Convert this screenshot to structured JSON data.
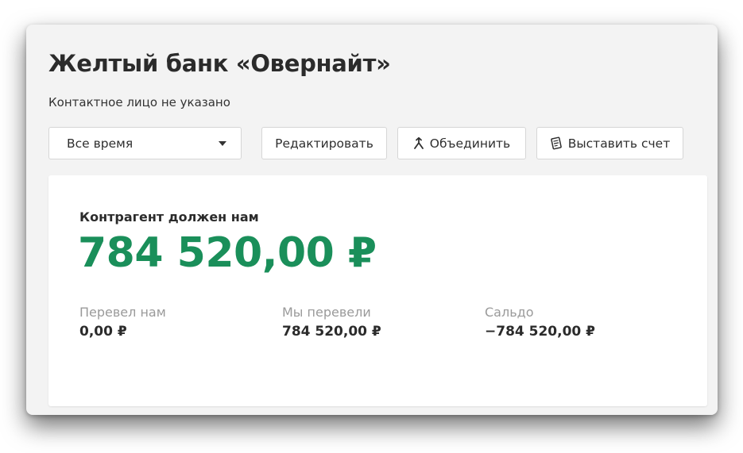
{
  "header": {
    "title": "Желтый банк «Овернайт»",
    "subtitle": "Контактное лицо не указано"
  },
  "toolbar": {
    "period_select": {
      "selected": "Все время"
    },
    "edit_label": "Редактировать",
    "merge_label": "Объединить",
    "merge_icon": "merge-icon",
    "invoice_label": "Выставить счет",
    "invoice_icon": "invoice-icon"
  },
  "summary": {
    "owes_label": "Контрагент должен нам",
    "owes_amount": "784 520,00 ₽",
    "stats": [
      {
        "label": "Перевел нам",
        "value": "0,00 ₽"
      },
      {
        "label": "Мы перевели",
        "value": "784 520,00 ₽"
      },
      {
        "label": "Сальдо",
        "value": "−784 520,00 ₽"
      }
    ]
  },
  "colors": {
    "accent_green": "#1a8f5a",
    "panel_bg": "#f3f3f3",
    "muted_text": "#9a9a9a"
  }
}
